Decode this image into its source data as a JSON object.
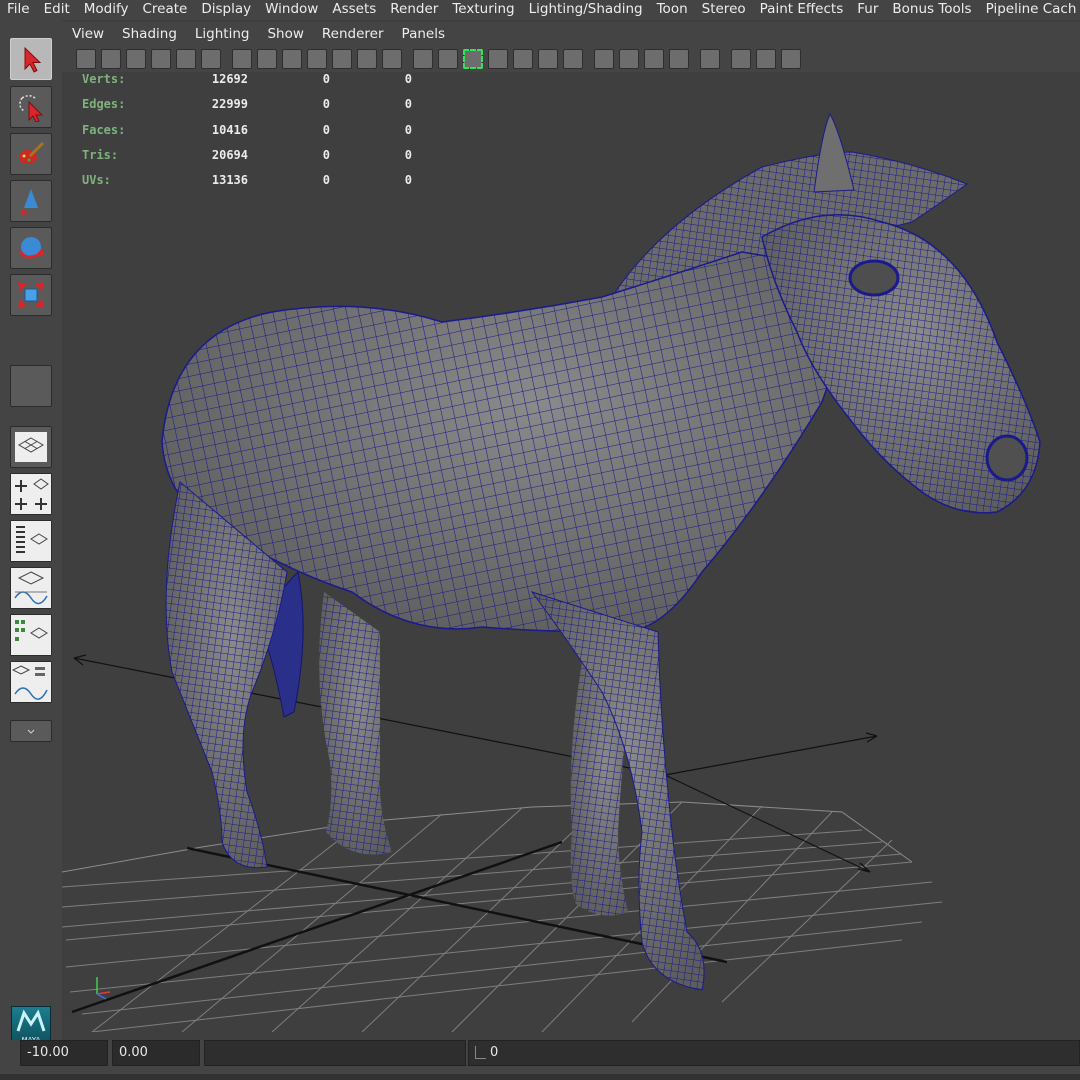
{
  "menubar": {
    "items": [
      "File",
      "Edit",
      "Modify",
      "Create",
      "Display",
      "Window",
      "Assets",
      "Render",
      "Texturing",
      "Lighting/Shading",
      "Toon",
      "Stereo",
      "Paint Effects",
      "Fur",
      "Bonus Tools",
      "Pipeline Cach"
    ]
  },
  "panel": {
    "menus": [
      "View",
      "Shading",
      "Lighting",
      "Show",
      "Renderer",
      "Panels"
    ]
  },
  "hud": {
    "rows": [
      {
        "label": "Verts:",
        "a": "12692",
        "b": "0",
        "c": "0"
      },
      {
        "label": "Edges:",
        "a": "22999",
        "b": "0",
        "c": "0"
      },
      {
        "label": "Faces:",
        "a": "10416",
        "b": "0",
        "c": "0"
      },
      {
        "label": "Tris:",
        "a": "20694",
        "b": "0",
        "c": "0"
      },
      {
        "label": "UVs:",
        "a": "13136",
        "b": "0",
        "c": "0"
      }
    ]
  },
  "timeline": {
    "start": "-10.00",
    "current": "0.00",
    "frame": "0"
  },
  "logo": {
    "text": "MAYA"
  },
  "colors": {
    "wireframe": "#1a1a8c",
    "hud_label": "#7fb27d",
    "background": "#3f3f3f"
  },
  "icons": {
    "tools": [
      "select-arrow-icon",
      "lasso-select-icon",
      "paint-select-icon",
      "move-tool-icon",
      "rotate-tool-icon",
      "scale-tool-icon"
    ],
    "layouts": [
      "single-perspective-layout-icon",
      "four-view-layout-icon",
      "outliner-persp-layout-icon",
      "persp-graph-layout-icon",
      "hypershade-persp-layout-icon",
      "persp-graph-hypershade-layout-icon"
    ]
  }
}
